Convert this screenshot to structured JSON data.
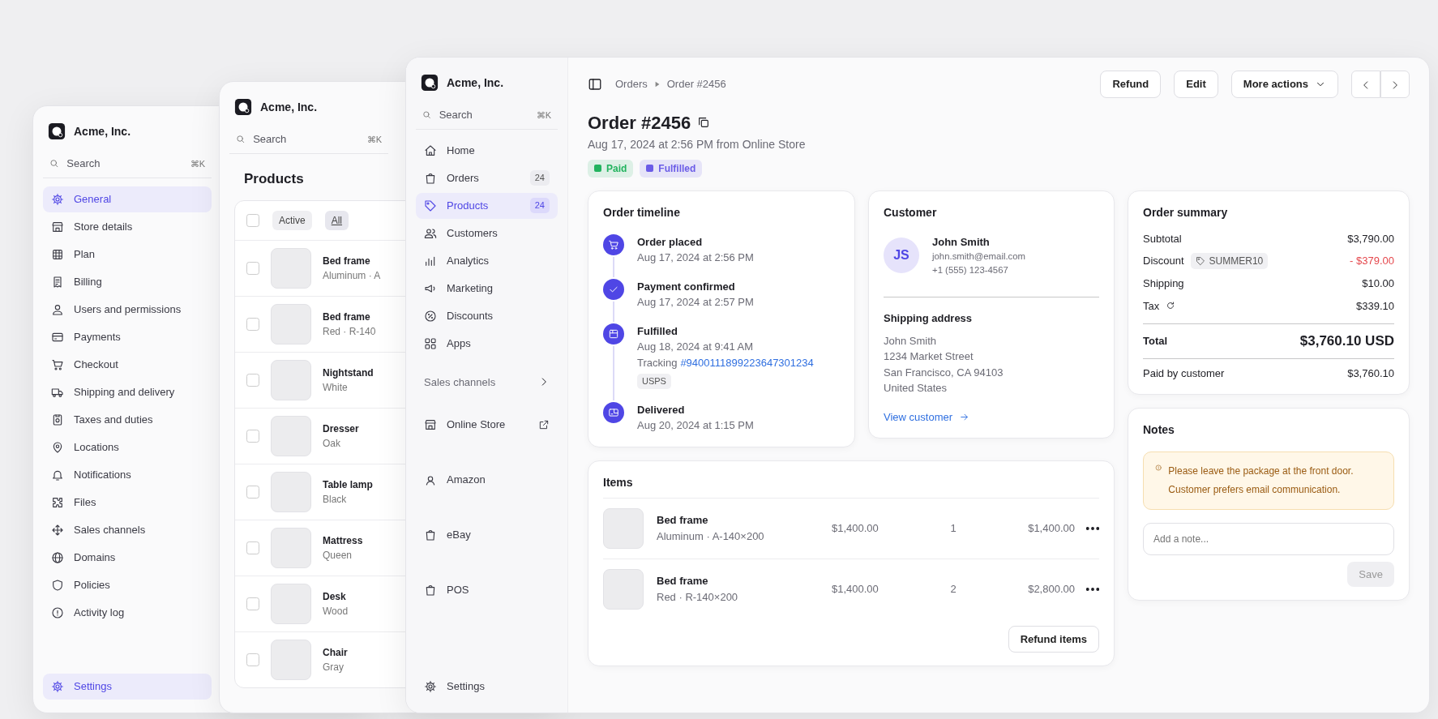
{
  "settings_window": {
    "brand": "Acme, Inc.",
    "search": {
      "placeholder": "Search",
      "shortcut": "⌘K"
    },
    "nav": [
      {
        "label": "General",
        "selected": true
      },
      {
        "label": "Store details",
        "selected": false
      },
      {
        "label": "Plan",
        "selected": false
      },
      {
        "label": "Billing",
        "selected": false
      },
      {
        "label": "Users and permissions",
        "selected": false
      },
      {
        "label": "Payments",
        "selected": false
      },
      {
        "label": "Checkout",
        "selected": false
      },
      {
        "label": "Shipping and delivery",
        "selected": false
      },
      {
        "label": "Taxes and duties",
        "selected": false
      },
      {
        "label": "Locations",
        "selected": false
      },
      {
        "label": "Notifications",
        "selected": false
      },
      {
        "label": "Files",
        "selected": false
      },
      {
        "label": "Sales channels",
        "selected": false
      },
      {
        "label": "Domains",
        "selected": false
      },
      {
        "label": "Policies",
        "selected": false
      },
      {
        "label": "Activity log",
        "selected": false
      }
    ],
    "footer_item": {
      "label": "Settings",
      "selected": true
    }
  },
  "products_window": {
    "brand": "Acme, Inc.",
    "search": {
      "placeholder": "Search",
      "shortcut": "⌘K"
    },
    "title": "Products",
    "select_all": {
      "checked": false
    },
    "filters": [
      {
        "label": "Active",
        "selected": false
      },
      {
        "label": "All",
        "selected": true
      }
    ],
    "rows": [
      {
        "name": "Bed frame",
        "detail": "Aluminum · A",
        "checked": false
      },
      {
        "name": "Bed frame",
        "detail": "Red · R-140",
        "checked": false
      },
      {
        "name": "Nightstand",
        "detail": "White",
        "checked": false
      },
      {
        "name": "Dresser",
        "detail": "Oak",
        "checked": false
      },
      {
        "name": "Table lamp",
        "detail": "Black",
        "checked": false
      },
      {
        "name": "Mattress",
        "detail": "Queen",
        "checked": false
      },
      {
        "name": "Desk",
        "detail": "Wood",
        "checked": false
      },
      {
        "name": "Chair",
        "detail": "Gray",
        "checked": false
      }
    ]
  },
  "order_window": {
    "brand": "Acme, Inc.",
    "search": {
      "placeholder": "Search",
      "shortcut": "⌘K"
    },
    "nav": [
      {
        "label": "Home",
        "selected": false
      },
      {
        "label": "Orders",
        "count": "24",
        "selected": false
      },
      {
        "label": "Products",
        "count": "24",
        "selected": true
      },
      {
        "label": "Customers",
        "selected": false
      },
      {
        "label": "Analytics",
        "selected": false
      },
      {
        "label": "Marketing",
        "selected": false
      },
      {
        "label": "Discounts",
        "selected": false
      },
      {
        "label": "Apps",
        "selected": false
      }
    ],
    "channels_heading": "Sales channels",
    "channels": [
      {
        "label": "Online Store",
        "external": true
      },
      {
        "label": "Amazon",
        "external": false
      },
      {
        "label": "eBay",
        "external": false
      },
      {
        "label": "POS",
        "external": false
      }
    ],
    "footer_item": {
      "label": "Settings",
      "selected": false
    },
    "breadcrumb": [
      "Orders",
      "Order #2456"
    ],
    "actions": [
      {
        "label": "Refund",
        "kind": "plain"
      },
      {
        "label": "Edit",
        "kind": "plain"
      },
      {
        "label": "More actions",
        "kind": "menu"
      }
    ],
    "title": "Order #2456",
    "subtitle": "Aug 17, 2024 at 2:56 PM from Online Store",
    "badges": [
      {
        "label": "Paid",
        "color": "#22b35e"
      },
      {
        "label": "Fulfilled",
        "color": "#6b5ce7"
      }
    ],
    "timeline": {
      "title": "Order timeline",
      "events": [
        {
          "title": "Order placed",
          "time": "Aug 17, 2024 at 2:56 PM"
        },
        {
          "title": "Payment confirmed",
          "time": "Aug 17, 2024 at 2:57 PM"
        },
        {
          "title": "Fulfilled",
          "time": "Aug 18, 2024 at 9:41 AM",
          "tracking_label": "Tracking",
          "tracking_number": "#9400111899223647301234",
          "carrier": "USPS"
        },
        {
          "title": "Delivered",
          "time": "Aug 20, 2024 at 1:15 PM"
        }
      ]
    },
    "customer": {
      "title": "Customer",
      "initials": "JS",
      "name": "John Smith",
      "email": "john.smith@email.com",
      "phone": "+1 (555) 123-4567",
      "address_title": "Shipping address",
      "address": [
        "John Smith",
        "1234 Market Street",
        "San Francisco, CA 94103",
        "United States"
      ],
      "link": "View customer"
    },
    "items": {
      "title": "Items",
      "rows": [
        {
          "name": "Bed frame",
          "variant": "Aluminum · A-140×200",
          "price": "$1,400.00",
          "quantity": "1",
          "total": "$1,400.00"
        },
        {
          "name": "Bed frame",
          "variant": "Red · R-140×200",
          "price": "$1,400.00",
          "quantity": "2",
          "total": "$2,800.00"
        }
      ],
      "button": "Refund items"
    },
    "summary": {
      "title": "Order summary",
      "lines": [
        {
          "label": "Subtotal",
          "value": "$3,790.00",
          "kind": "plain"
        },
        {
          "label": "Discount",
          "code": "SUMMER10",
          "value": "- $379.00",
          "kind": "discount"
        },
        {
          "label": "Shipping",
          "value": "$10.00",
          "kind": "plain"
        },
        {
          "label": "Tax",
          "value": "$339.10",
          "kind": "tax"
        }
      ],
      "total_label": "Total",
      "total": "$3,760.10 USD",
      "paid_label": "Paid by customer",
      "paid": "$3,760.10"
    },
    "notes": {
      "title": "Notes",
      "note": "Please leave the package at the front door. Customer prefers email communication.",
      "placeholder": "Add a note...",
      "save": {
        "label": "Save",
        "disabled": true
      }
    }
  }
}
